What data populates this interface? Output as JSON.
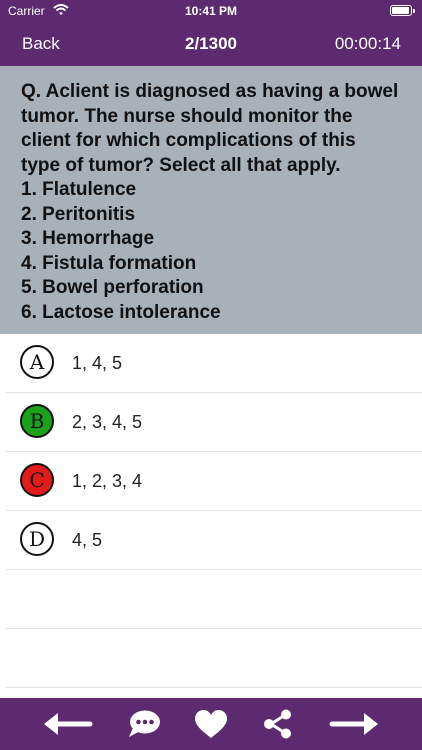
{
  "status_bar": {
    "carrier": "Carrier",
    "time": "10:41 PM",
    "icons": [
      "wifi-icon",
      "battery-icon"
    ]
  },
  "nav": {
    "back_label": "Back",
    "progress": "2/1300",
    "timer": "00:00:14"
  },
  "question": {
    "lines": [
      "Q. Aclient is diagnosed as having a bowel",
      "tumor. The nurse should monitor the",
      "client for which complications of this",
      "type of tumor? Select all that apply.",
      "1. Flatulence",
      "2. Peritonitis",
      "3. Hemorrhage",
      "4. Fistula formation",
      "5. Bowel perforation",
      "6. Lactose intolerance"
    ]
  },
  "answers": [
    {
      "letter": "A",
      "text": "1, 4, 5",
      "state": "unselected",
      "color": "#ffffff"
    },
    {
      "letter": "B",
      "text": "2, 3, 4, 5",
      "state": "correct",
      "color": "#1aa21a"
    },
    {
      "letter": "C",
      "text": "1, 2, 3, 4",
      "state": "wrong",
      "color": "#e21a1a"
    },
    {
      "letter": "D",
      "text": "4, 5",
      "state": "unselected",
      "color": "#ffffff"
    }
  ],
  "toolbar": {
    "icons": [
      "arrow-left-icon",
      "comment-icon",
      "heart-icon",
      "share-icon",
      "arrow-right-icon"
    ]
  },
  "colors": {
    "header": "#5b2a6f",
    "question_bg": "#a8b0b8",
    "correct": "#1aa21a",
    "wrong": "#e21a1a"
  }
}
